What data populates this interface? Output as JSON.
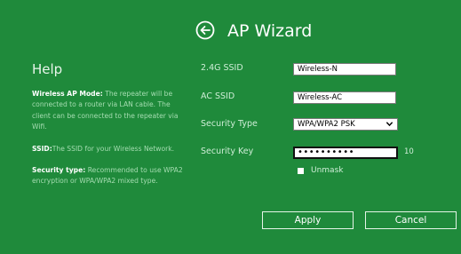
{
  "header": {
    "title": "AP Wizard",
    "back_icon": "back-arrow-circle-icon"
  },
  "help": {
    "title": "Help",
    "sections": [
      {
        "term": "Wireless AP Mode:",
        "text": " The repeater will be connected to a router via LAN cable. The client can be connected to the repeater via Wifi."
      },
      {
        "term": "SSID:",
        "text": "The SSID for your Wireless Network."
      },
      {
        "term": "Security type:",
        "text": " Recommended to use WPA2 encryption or WPA/WPA2 mixed type."
      }
    ]
  },
  "form": {
    "ssid_24g_label": "2.4G SSID",
    "ssid_24g_value": "Wireless-N",
    "ssid_ac_label": "AC SSID",
    "ssid_ac_value": "Wireless-AC",
    "security_type_label": "Security Type",
    "security_type_value": "WPA/WPA2 PSK",
    "security_key_label": "Security Key",
    "security_key_masked": "••••••••••",
    "security_key_length": "10",
    "unmask_label": "Unmask"
  },
  "buttons": {
    "apply": "Apply",
    "cancel": "Cancel"
  },
  "colors": {
    "background": "#1f8a3b",
    "help_text": "#a5ddb1",
    "text": "#ffffff"
  }
}
